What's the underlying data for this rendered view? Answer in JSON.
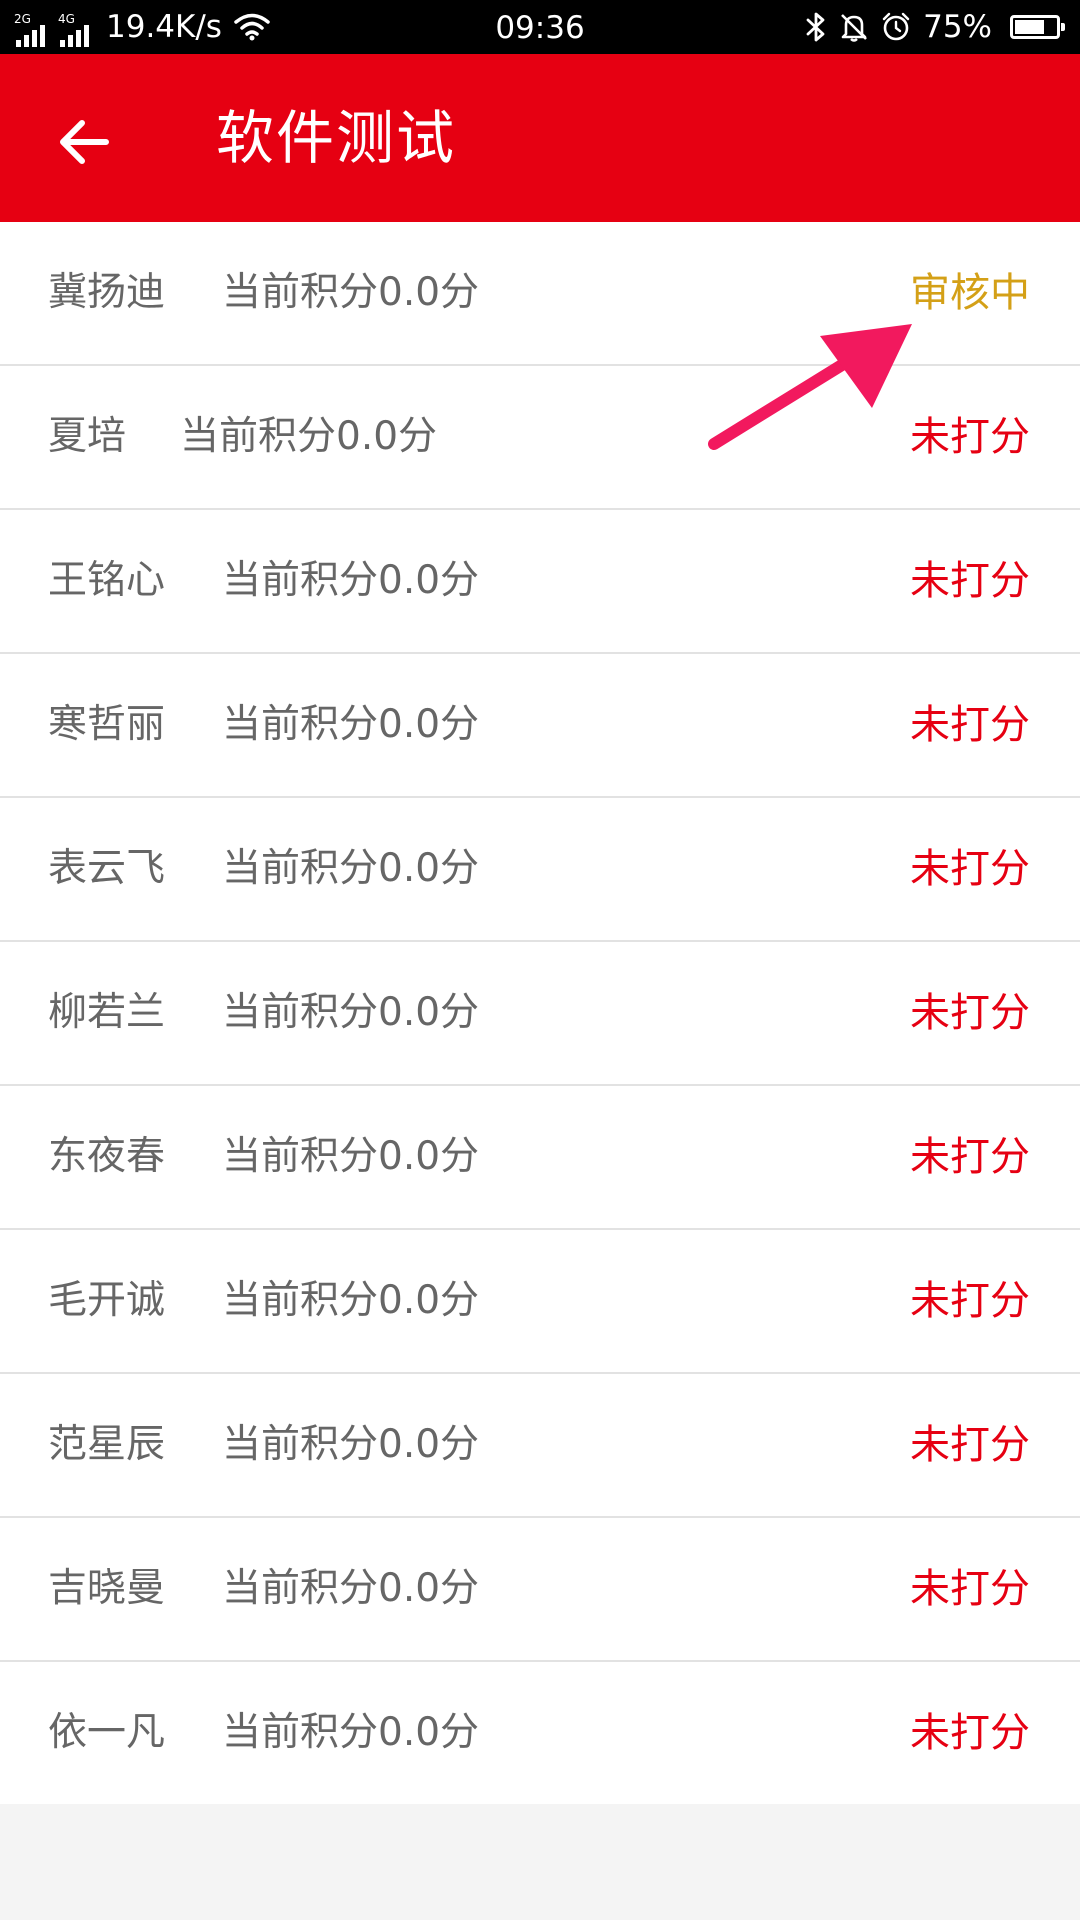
{
  "status_bar": {
    "sim1_tag": "2G",
    "sim2_tag": "4G",
    "net_speed": "19.4K/s",
    "time": "09:36",
    "battery_percent": "75%",
    "battery_level": 0.75,
    "icons": [
      "signal-icon",
      "signal-icon",
      "wifi-icon",
      "bluetooth-icon",
      "mute-icon",
      "alarm-icon",
      "battery-icon"
    ]
  },
  "header": {
    "title": "软件测试",
    "back_icon": "arrow-left-icon",
    "color": "#e60012"
  },
  "list": {
    "items": [
      {
        "name": "冀扬迪",
        "score": "当前积分0.0分",
        "status": "审核中",
        "status_color": "#d4a017"
      },
      {
        "name": "夏培",
        "score": "当前积分0.0分",
        "status": "未打分",
        "status_color": "#e60012"
      },
      {
        "name": "王铭心",
        "score": "当前积分0.0分",
        "status": "未打分",
        "status_color": "#e60012"
      },
      {
        "name": "寒哲丽",
        "score": "当前积分0.0分",
        "status": "未打分",
        "status_color": "#e60012"
      },
      {
        "name": "表云飞",
        "score": "当前积分0.0分",
        "status": "未打分",
        "status_color": "#e60012"
      },
      {
        "name": "柳若兰",
        "score": "当前积分0.0分",
        "status": "未打分",
        "status_color": "#e60012"
      },
      {
        "name": "东夜春",
        "score": "当前积分0.0分",
        "status": "未打分",
        "status_color": "#e60012"
      },
      {
        "name": "毛开诚",
        "score": "当前积分0.0分",
        "status": "未打分",
        "status_color": "#e60012"
      },
      {
        "name": "范星辰",
        "score": "当前积分0.0分",
        "status": "未打分",
        "status_color": "#e60012"
      },
      {
        "name": "吉晓曼",
        "score": "当前积分0.0分",
        "status": "未打分",
        "status_color": "#e60012"
      },
      {
        "name": "依一凡",
        "score": "当前积分0.0分",
        "status": "未打分",
        "status_color": "#e60012"
      }
    ]
  },
  "annotation": {
    "type": "arrow-icon",
    "color": "#f2195e"
  }
}
